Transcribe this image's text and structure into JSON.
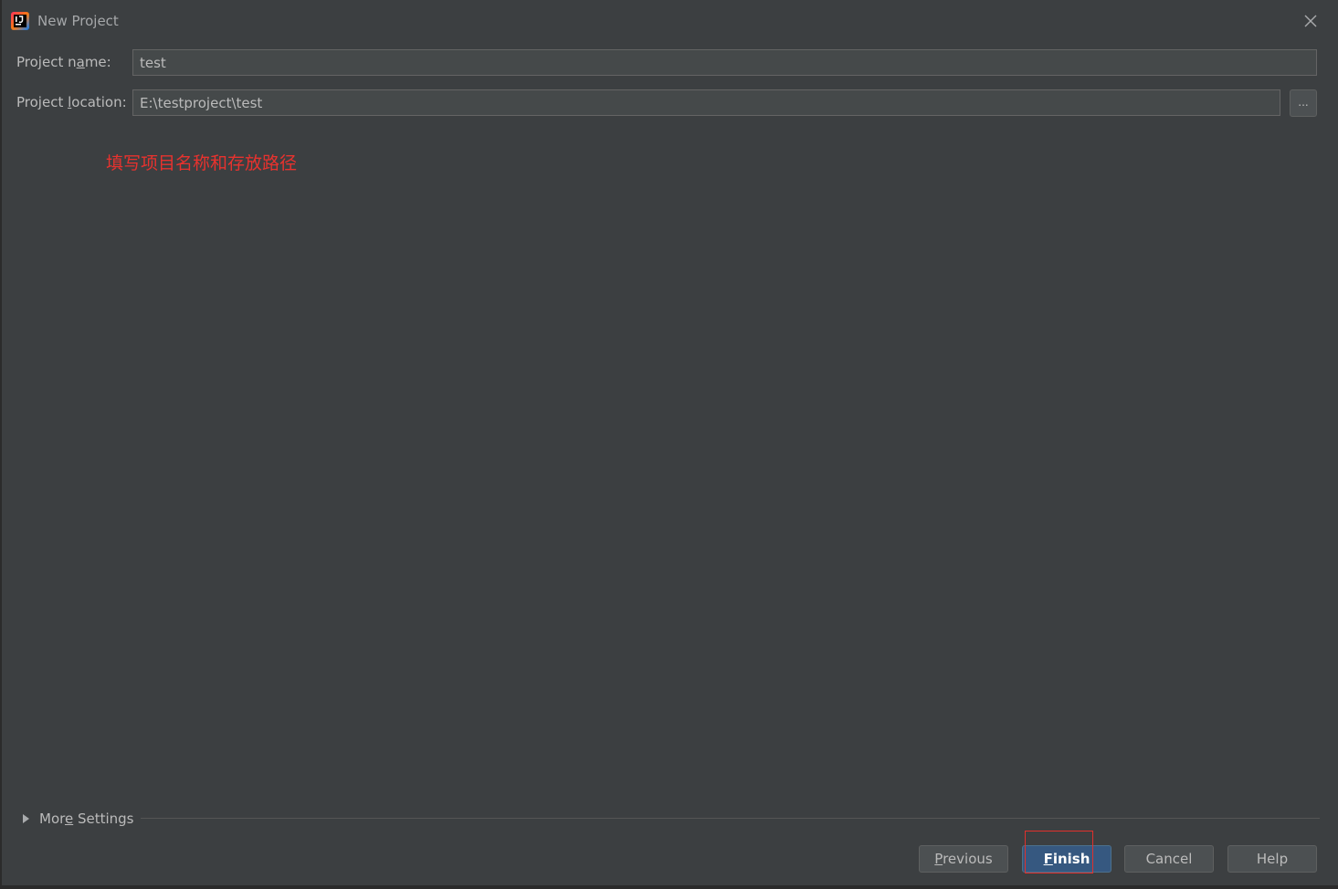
{
  "window": {
    "title": "New Project"
  },
  "form": {
    "project_name": {
      "label_pre": "Project n",
      "label_mnemonic": "a",
      "label_post": "me:",
      "value": "test"
    },
    "project_location": {
      "label_pre": "Project ",
      "label_mnemonic": "l",
      "label_post": "ocation:",
      "value": "E:\\testproject\\test",
      "browse_label": "..."
    }
  },
  "annotation": {
    "text": "填写项目名称和存放路径",
    "color": "#e8322e"
  },
  "more_settings": {
    "label_pre": "Mor",
    "label_mnemonic": "e",
    "label_post": " Settings"
  },
  "buttons": {
    "previous": {
      "mnemonic": "P",
      "rest": "revious"
    },
    "finish": {
      "mnemonic": "F",
      "rest": "inish"
    },
    "cancel": {
      "label": "Cancel"
    },
    "help": {
      "label": "Help"
    }
  },
  "icons": {
    "app": "intellij-idea-icon",
    "close": "close-icon",
    "expand": "triangle-right-icon"
  },
  "colors": {
    "background": "#3c3f41",
    "input_background": "#45494a",
    "default_button": "#365880",
    "highlight": "#e0302c"
  }
}
